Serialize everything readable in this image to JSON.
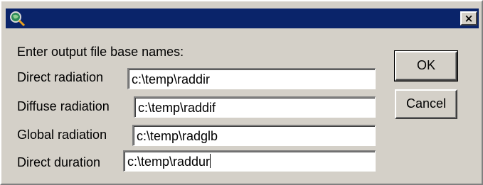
{
  "titlebar": {
    "icon": "magnifier-globe-icon",
    "close_label": "×"
  },
  "prompt": "Enter output file base names:",
  "fields": [
    {
      "label": "Direct radiation",
      "value": "c:\\temp\\raddir"
    },
    {
      "label": "Diffuse radiation",
      "value": "c:\\temp\\raddif"
    },
    {
      "label": "Global radiation",
      "value": "c:\\temp\\radglb"
    },
    {
      "label": "Direct duration",
      "value": "c:\\temp\\raddur"
    }
  ],
  "buttons": {
    "ok_label": "OK",
    "cancel_label": "Cancel"
  },
  "colors": {
    "titlebar": "#0a246a",
    "face": "#d4d0c8"
  }
}
